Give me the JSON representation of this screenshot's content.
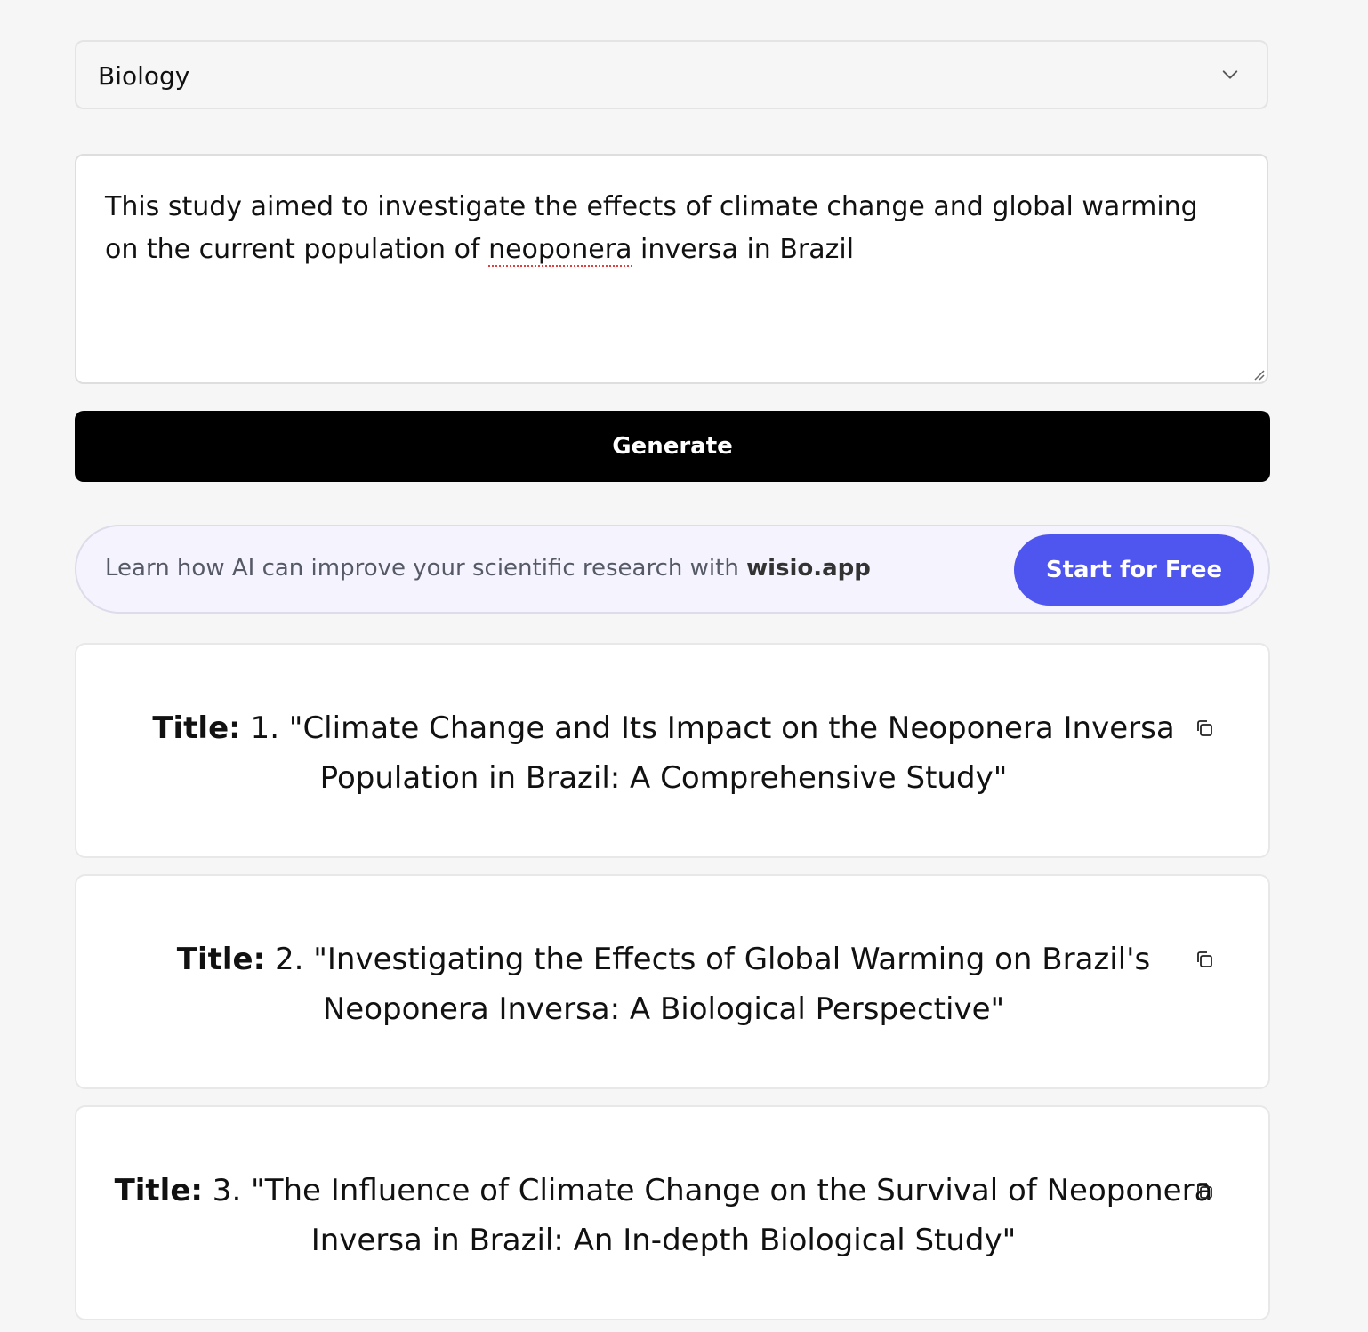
{
  "subject_select": {
    "value": "Biology",
    "icon": "chevron-down-icon"
  },
  "abstract_input": {
    "text_before": "This study aimed to investigate the effects of climate change and global warming on the current population of ",
    "text_misspelled": "neoponera",
    "text_after": " inversa in Brazil"
  },
  "generate_button": {
    "label": "Generate"
  },
  "promo": {
    "text": "Learn how AI can improve your scientific research with ",
    "brand": "wisio.app",
    "button_label": "Start for Free",
    "button_color": "#4f55ef"
  },
  "results": [
    {
      "label": "Title:",
      "text": " 1. \"Climate Change and Its Impact on the Neoponera Inversa Population in Brazil: A Comprehensive Study\""
    },
    {
      "label": "Title:",
      "text": " 2. \"Investigating the Effects of Global Warming on Brazil's Neoponera Inversa: A Biological Perspective\""
    },
    {
      "label": "Title:",
      "text": " 3. \"The Influence of Climate Change on the Survival of Neoponera Inversa in Brazil: An In-depth Biological Study\""
    }
  ]
}
